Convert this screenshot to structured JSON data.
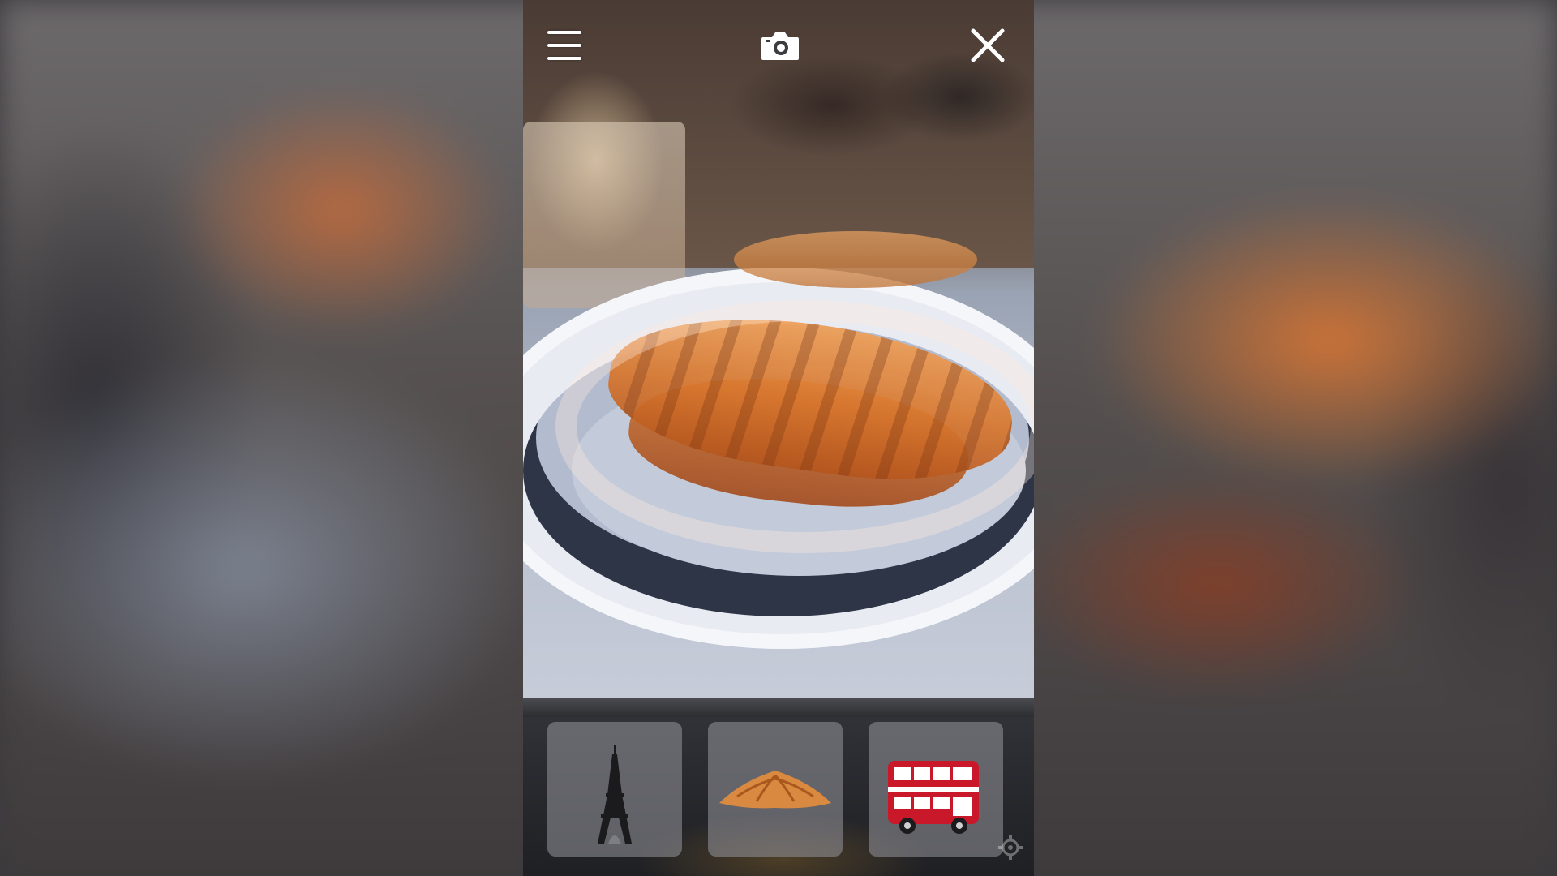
{
  "app": {
    "view": "ar-camera"
  },
  "top_bar": {
    "menu_icon": "hamburger-menu-icon",
    "capture_icon": "camera-icon",
    "close_icon": "close-icon"
  },
  "scene": {
    "subject": "",
    "overlay": ""
  },
  "models_tray": {
    "items": [
      {
        "icon": "eiffel-tower-icon",
        "label": ""
      },
      {
        "icon": "croissant-icon",
        "label": ""
      },
      {
        "icon": "double-decker-bus-icon",
        "label": ""
      }
    ],
    "selected_index": 1
  },
  "colors": {
    "icon_white": "#ffffff",
    "bus_red": "#c8182a",
    "croissant": "#d98a40",
    "tray_bg": "#2a2b30"
  }
}
